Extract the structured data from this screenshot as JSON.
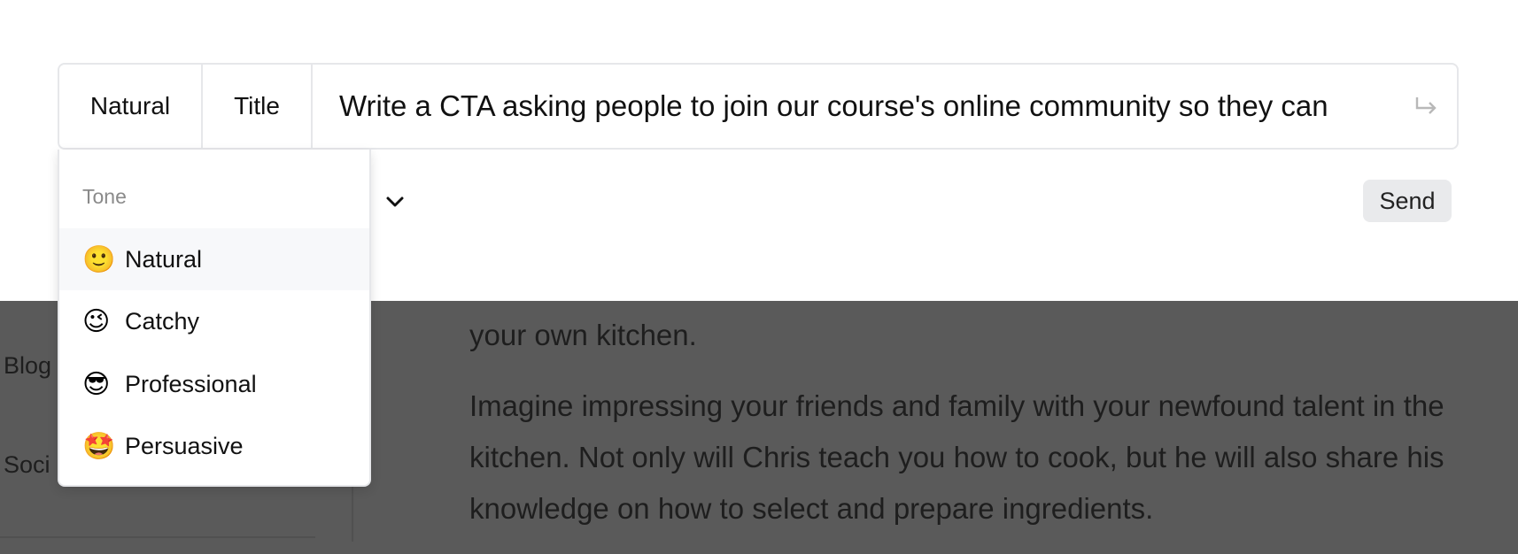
{
  "prompt_bar": {
    "tone_label": "Natural",
    "type_label": "Title",
    "prompt_text": "Write a CTA asking people to join our course's online community so they can"
  },
  "send_label": "Send",
  "tone_menu": {
    "header": "Tone",
    "items": [
      {
        "emoji": "🙂",
        "label": "Natural",
        "selected": true
      },
      {
        "emoji": "😉",
        "label": "Catchy",
        "selected": false
      },
      {
        "emoji": "😎",
        "label": "Professional",
        "selected": false
      },
      {
        "emoji": "🤩",
        "label": "Persuasive",
        "selected": false
      }
    ]
  },
  "background": {
    "sidebar_items": [
      "Blog",
      "Soci"
    ],
    "article_paragraphs": [
      "your own kitchen.",
      "Imagine impressing your friends and family with your newfound talent in the kitchen. Not only will Chris teach you how to cook, but he will also share his knowledge on how to select and prepare ingredients."
    ]
  }
}
